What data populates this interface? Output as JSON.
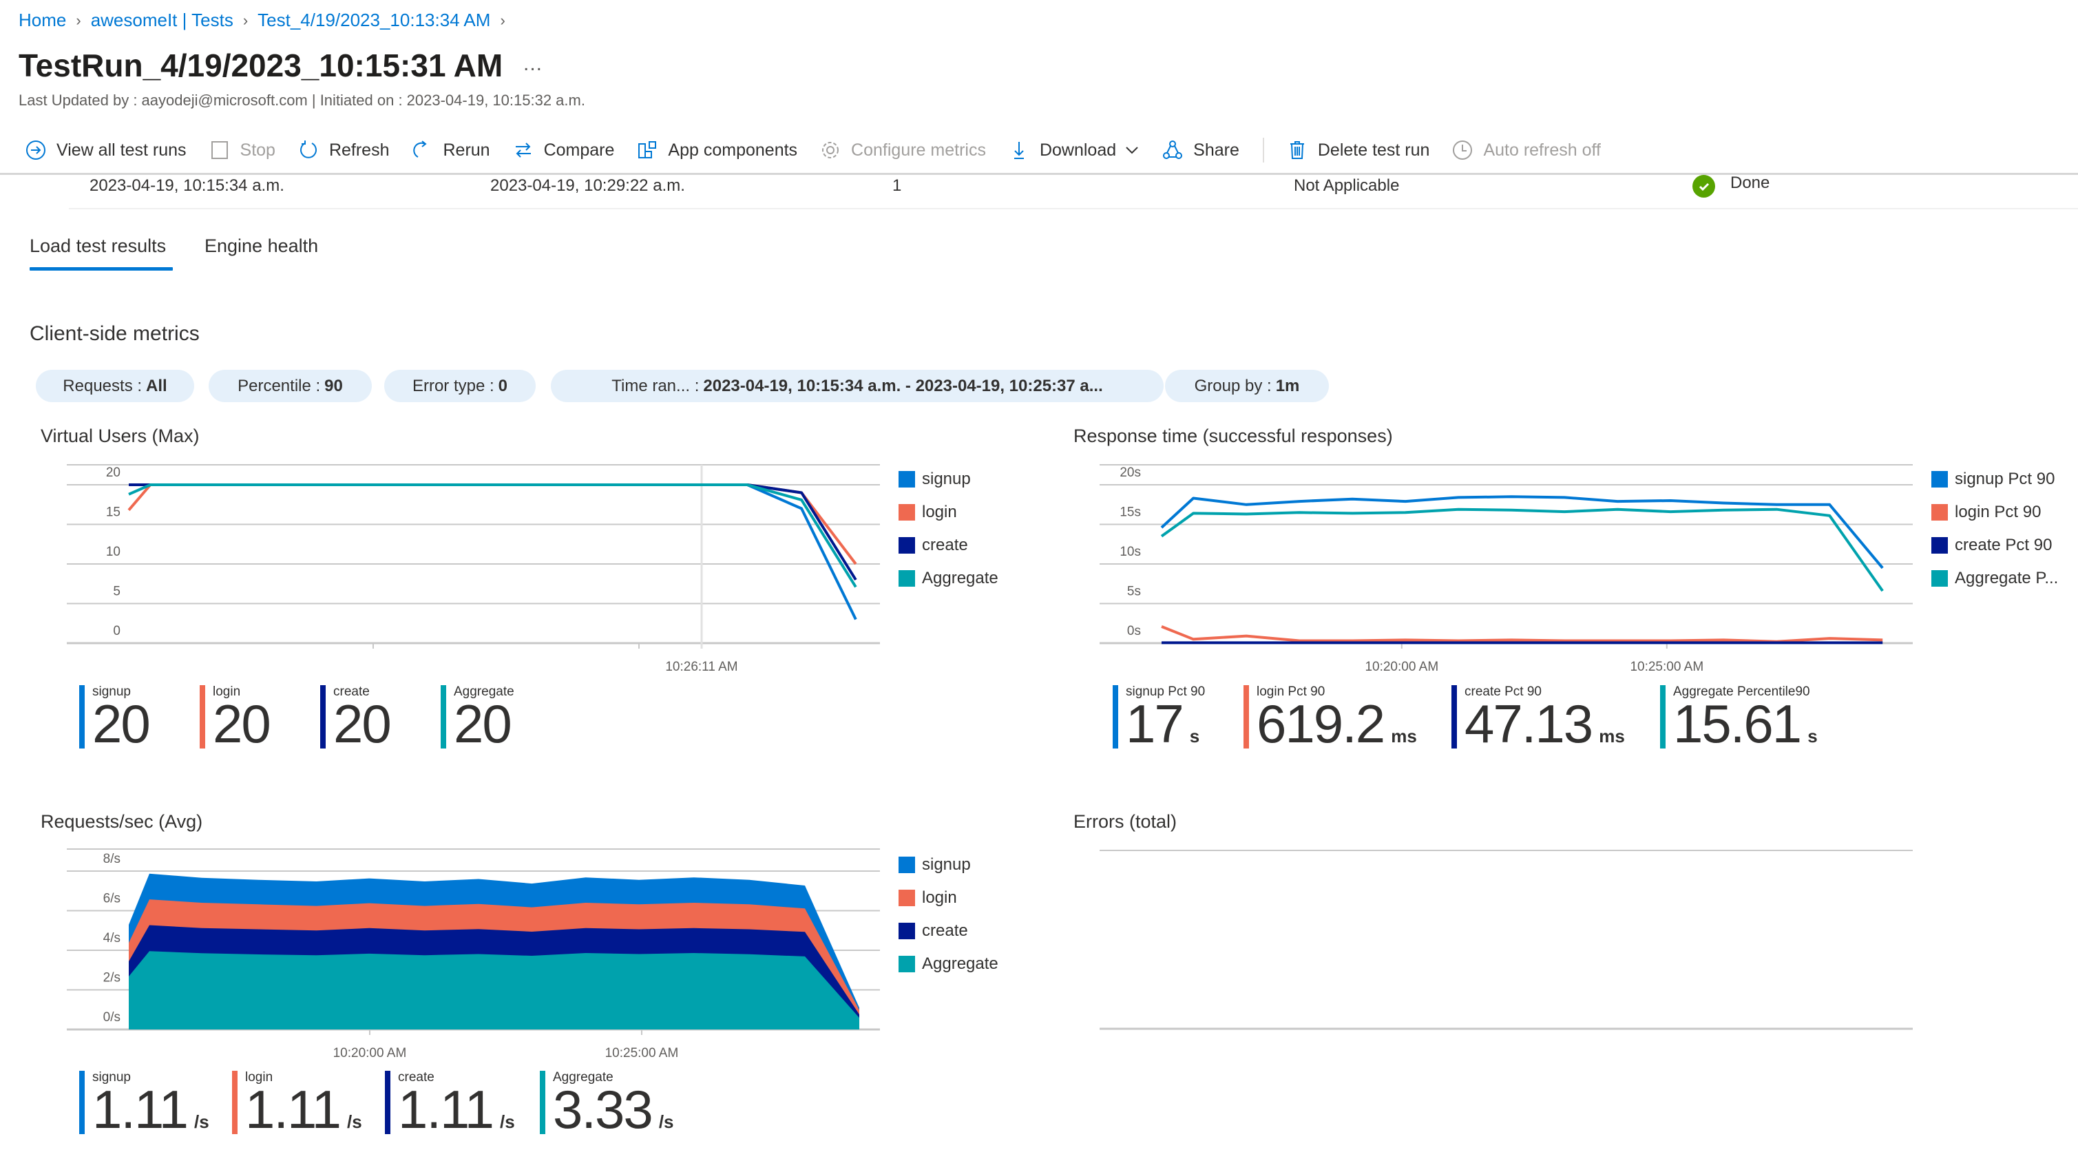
{
  "breadcrumb": [
    {
      "label": "Home"
    },
    {
      "label": "awesomeIt | Tests"
    },
    {
      "label": "Test_4/19/2023_10:13:34 AM"
    }
  ],
  "page": {
    "title": "TestRun_4/19/2023_10:15:31 AM",
    "more_label": "...",
    "subtitle": "Last Updated by : aayodeji@microsoft.com | Initiated on : 2023-04-19, 10:15:32 a.m."
  },
  "toolbar": {
    "view_all": "View all test runs",
    "stop": "Stop",
    "refresh": "Refresh",
    "rerun": "Rerun",
    "compare": "Compare",
    "app_components": "App components",
    "configure_metrics": "Configure metrics",
    "download": "Download",
    "share": "Share",
    "delete": "Delete test run",
    "auto_refresh": "Auto refresh off"
  },
  "run_info": {
    "start_time": "2023-04-19, 10:15:34 a.m.",
    "end_time": "2023-04-19, 10:29:22 a.m.",
    "engines": "1",
    "criteria": "Not Applicable",
    "status": "Done"
  },
  "tabs": [
    {
      "label": "Load test results",
      "active": true
    },
    {
      "label": "Engine health",
      "active": false
    }
  ],
  "section_title": "Client-side metrics",
  "filters": [
    {
      "label": "Requests :",
      "value": "All"
    },
    {
      "label": "Percentile :",
      "value": "90"
    },
    {
      "label": "Error type :",
      "value": "0"
    },
    {
      "label": "Time ran... :",
      "value": "2023-04-19, 10:15:34 a.m. - 2023-04-19, 10:25:37 a..."
    },
    {
      "label": "Group by :",
      "value": "1m"
    }
  ],
  "colors": {
    "signup": "#0078d4",
    "login": "#ef6950",
    "create": "#00188f",
    "aggregate": "#00a2ad",
    "accent": "#0078d4",
    "success": "#57a300"
  },
  "chart_data": [
    {
      "id": "vu",
      "type": "line",
      "title": "Virtual Users (Max)",
      "xlabel": "",
      "ylabel": "",
      "ylim": [
        0,
        20
      ],
      "yticks": [
        "0",
        "5",
        "10",
        "15",
        "20"
      ],
      "xticks": [],
      "crosshair_label": "10:26:11 AM",
      "grid": true,
      "legend_position": "right",
      "x": [
        0,
        0.4,
        1.4,
        2.4,
        3.4,
        4.4,
        5.4,
        6.4,
        7.4,
        8.4,
        9.4,
        10.4,
        11.4,
        12.4,
        13.4
      ],
      "series": [
        {
          "name": "signup",
          "color_key": "signup",
          "values": [
            20,
            20,
            20,
            20,
            20,
            20,
            20,
            20,
            20,
            20,
            20,
            20,
            20,
            17.0,
            3.0
          ]
        },
        {
          "name": "login",
          "color_key": "login",
          "values": [
            16.8,
            20,
            20,
            20,
            20,
            20,
            20,
            20,
            20,
            20,
            20,
            20,
            20,
            19.0,
            10.0
          ]
        },
        {
          "name": "create",
          "color_key": "create",
          "values": [
            20,
            20,
            20,
            20,
            20,
            20,
            20,
            20,
            20,
            20,
            20,
            20,
            20,
            19.0,
            8.0
          ]
        },
        {
          "name": "Aggregate",
          "color_key": "aggregate",
          "values": [
            18.8,
            20,
            20,
            20,
            20,
            20,
            20,
            20,
            20,
            20,
            20,
            20,
            20,
            18.1,
            7.1
          ]
        }
      ],
      "stats": [
        {
          "label": "signup",
          "value": "20",
          "unit": "",
          "color_key": "signup"
        },
        {
          "label": "login",
          "value": "20",
          "unit": "",
          "color_key": "login"
        },
        {
          "label": "create",
          "value": "20",
          "unit": "",
          "color_key": "create"
        },
        {
          "label": "Aggregate",
          "value": "20",
          "unit": "",
          "color_key": "aggregate"
        }
      ]
    },
    {
      "id": "rt",
      "type": "line",
      "title": "Response time (successful responses)",
      "xlabel": "",
      "ylabel": "",
      "ylim": [
        0,
        20
      ],
      "yticks": [
        "0s",
        "5s",
        "10s",
        "15s",
        "20s"
      ],
      "xticks": [
        {
          "label": "10:20:00 AM",
          "x": 4.53
        },
        {
          "label": "10:25:00 AM",
          "x": 9.53
        }
      ],
      "grid": true,
      "legend_position": "right",
      "x": [
        0,
        0.6,
        1.6,
        2.6,
        3.6,
        4.6,
        5.6,
        6.6,
        7.6,
        8.6,
        9.6,
        10.6,
        11.6,
        12.6,
        13.6
      ],
      "series": [
        {
          "name": "signup Pct 90",
          "color_key": "signup",
          "values": [
            14.6,
            18.3,
            17.5,
            17.9,
            18.2,
            17.9,
            18.4,
            18.5,
            18.4,
            17.9,
            18.0,
            17.7,
            17.5,
            17.5,
            9.5
          ]
        },
        {
          "name": "login Pct 90",
          "color_key": "login",
          "values": [
            2.1,
            0.5,
            0.9,
            0.3,
            0.3,
            0.4,
            0.3,
            0.4,
            0.3,
            0.3,
            0.3,
            0.4,
            0.2,
            0.6,
            0.4
          ]
        },
        {
          "name": "create Pct 90",
          "color_key": "create",
          "values": [
            0.05,
            0.05,
            0.05,
            0.05,
            0.05,
            0.05,
            0.05,
            0.05,
            0.05,
            0.05,
            0.05,
            0.05,
            0.05,
            0.05,
            0.05
          ]
        },
        {
          "name": "Aggregate P...",
          "color_key": "aggregate",
          "values": [
            13.5,
            16.4,
            16.3,
            16.5,
            16.4,
            16.5,
            16.9,
            16.8,
            16.6,
            16.9,
            16.6,
            16.8,
            16.9,
            16.1,
            6.6
          ]
        }
      ],
      "stats": [
        {
          "label": "signup Pct 90",
          "value": "17",
          "unit": "s",
          "color_key": "signup"
        },
        {
          "label": "login Pct 90",
          "value": "619.2",
          "unit": "ms",
          "color_key": "login"
        },
        {
          "label": "create Pct 90",
          "value": "47.13",
          "unit": "ms",
          "color_key": "create"
        },
        {
          "label": "Aggregate Percentile90",
          "value": "15.61",
          "unit": "s",
          "color_key": "aggregate"
        }
      ]
    },
    {
      "id": "rps",
      "type": "area",
      "stacked": true,
      "title": "Requests/sec (Avg)",
      "xlabel": "",
      "ylabel": "",
      "ylim": [
        0,
        8
      ],
      "yticks": [
        "0/s",
        "2/s",
        "4/s",
        "6/s",
        "8/s"
      ],
      "xticks": [
        {
          "label": "10:20:00 AM",
          "x": 4.43
        },
        {
          "label": "10:25:00 AM",
          "x": 9.43
        }
      ],
      "grid": true,
      "legend_position": "right",
      "x": [
        0,
        0.38,
        1.34,
        2.39,
        3.45,
        4.42,
        5.44,
        6.43,
        7.41,
        8.4,
        9.38,
        10.39,
        11.41,
        12.43,
        13.43
      ],
      "series": [
        {
          "name": "Aggregate",
          "color_key": "aggregate",
          "values": [
            2.68,
            3.96,
            3.85,
            3.79,
            3.75,
            3.83,
            3.75,
            3.81,
            3.72,
            3.86,
            3.81,
            3.86,
            3.8,
            3.69,
            0.59
          ]
        },
        {
          "name": "create",
          "color_key": "create",
          "values": [
            0.76,
            1.31,
            1.27,
            1.27,
            1.25,
            1.29,
            1.25,
            1.26,
            1.22,
            1.26,
            1.25,
            1.26,
            1.26,
            1.24,
            0.17
          ]
        },
        {
          "name": "login",
          "color_key": "login",
          "values": [
            0.94,
            1.3,
            1.28,
            1.26,
            1.24,
            1.26,
            1.24,
            1.27,
            1.23,
            1.28,
            1.26,
            1.28,
            1.26,
            1.18,
            0.22
          ]
        },
        {
          "name": "signup",
          "color_key": "signup",
          "values": [
            0.91,
            1.3,
            1.26,
            1.24,
            1.24,
            1.25,
            1.24,
            1.26,
            1.2,
            1.28,
            1.24,
            1.28,
            1.24,
            1.16,
            0.12
          ]
        }
      ],
      "legend_order": [
        "signup",
        "login",
        "create",
        "Aggregate"
      ],
      "stats": [
        {
          "label": "signup",
          "value": "1.11",
          "unit": "/s",
          "color_key": "signup"
        },
        {
          "label": "login",
          "value": "1.11",
          "unit": "/s",
          "color_key": "login"
        },
        {
          "label": "create",
          "value": "1.11",
          "unit": "/s",
          "color_key": "create"
        },
        {
          "label": "Aggregate",
          "value": "3.33",
          "unit": "/s",
          "color_key": "aggregate"
        }
      ]
    },
    {
      "id": "errors",
      "type": "line",
      "title": "Errors (total)",
      "series": [],
      "grid": true
    }
  ]
}
